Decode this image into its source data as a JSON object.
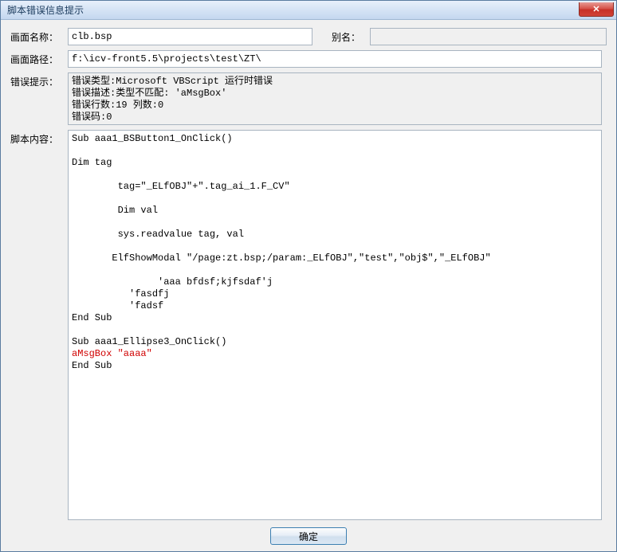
{
  "window": {
    "title": "脚本错误信息提示",
    "close": "✕"
  },
  "labels": {
    "screen_name": "画面名称：",
    "alias": "别名：",
    "screen_path": "画面路径：",
    "error_hint": "错误提示：",
    "script_content": "脚本内容："
  },
  "fields": {
    "screen_name": "clb.bsp",
    "alias": "",
    "screen_path": "f:\\icv-front5.5\\projects\\test\\ZT\\"
  },
  "error_lines": [
    "错误类型:Microsoft VBScript 运行时错误",
    "错误描述:类型不匹配: 'aMsgBox'",
    "错误行数:19 列数:0",
    "错误码:0"
  ],
  "script_lines": [
    {
      "t": "Sub aaa1_BSButton1_OnClick()",
      "err": false
    },
    {
      "t": "",
      "err": false
    },
    {
      "t": "Dim tag",
      "err": false
    },
    {
      "t": "",
      "err": false
    },
    {
      "t": "        tag=\"_ELfOBJ\"+\".tag_ai_1.F_CV\"",
      "err": false
    },
    {
      "t": "",
      "err": false
    },
    {
      "t": "        Dim val",
      "err": false
    },
    {
      "t": "",
      "err": false
    },
    {
      "t": "        sys.readvalue tag, val",
      "err": false
    },
    {
      "t": "",
      "err": false
    },
    {
      "t": "       ElfShowModal \"/page:zt.bsp;/param:_ELfOBJ\",\"test\",\"obj$\",\"_ELfOBJ\"",
      "err": false
    },
    {
      "t": "",
      "err": false
    },
    {
      "t": "               'aaa bfdsf;kjfsdaf'j",
      "err": false
    },
    {
      "t": "          'fasdfj",
      "err": false
    },
    {
      "t": "          'fadsf",
      "err": false
    },
    {
      "t": "End Sub",
      "err": false
    },
    {
      "t": "",
      "err": false
    },
    {
      "t": "Sub aaa1_Ellipse3_OnClick()",
      "err": false
    },
    {
      "t": "aMsgBox \"aaaa\"",
      "err": true
    },
    {
      "t": "End Sub",
      "err": false
    }
  ],
  "footer": {
    "ok": "确定"
  }
}
